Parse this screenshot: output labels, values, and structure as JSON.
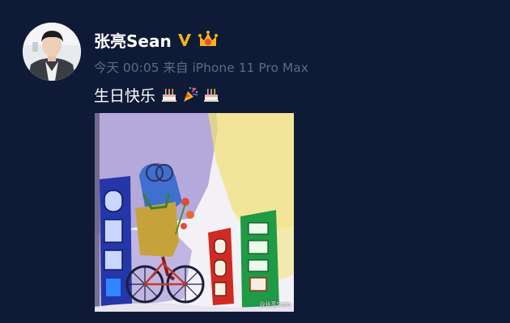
{
  "user": {
    "name": "张亮Sean",
    "avatar_icon": "avatar-photo",
    "badges": [
      "verified-v-icon",
      "crown-member-icon"
    ]
  },
  "post": {
    "meta": "今天 00:05 来自 iPhone 11 Pro Max",
    "text": "生日快乐",
    "emojis": [
      "birthday-cake-icon",
      "celebration-icon",
      "birthday-cake-icon"
    ],
    "image": {
      "description_icon": "child-drawing-image",
      "watermark": "@张亮Sean"
    }
  },
  "colors": {
    "background": "#0f1b36",
    "meta_text": "#5d6a85",
    "verified": "#f6b21c",
    "crown": "#f6b21c"
  }
}
